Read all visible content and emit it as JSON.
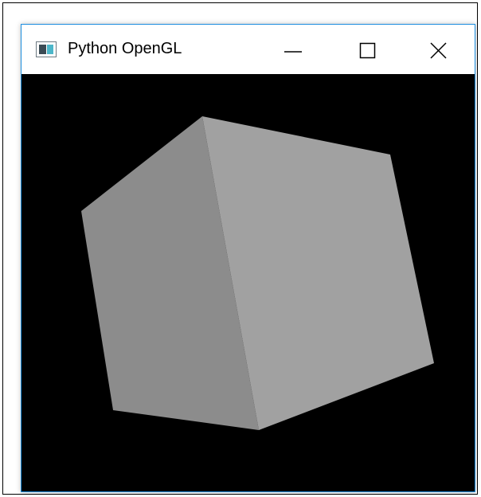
{
  "window": {
    "title": "Python OpenGL",
    "title_bar_background": "#ffffff",
    "border_color": "#1e8fe0",
    "controls": {
      "minimize_icon": "minimize-icon",
      "maximize_icon": "maximize-icon",
      "close_icon": "close-icon"
    }
  },
  "viewport": {
    "background": "#000000",
    "scene": {
      "object": "cube",
      "colors": {
        "left_face": "#8c8c8c",
        "right_face": "#a1a1a1"
      }
    }
  }
}
